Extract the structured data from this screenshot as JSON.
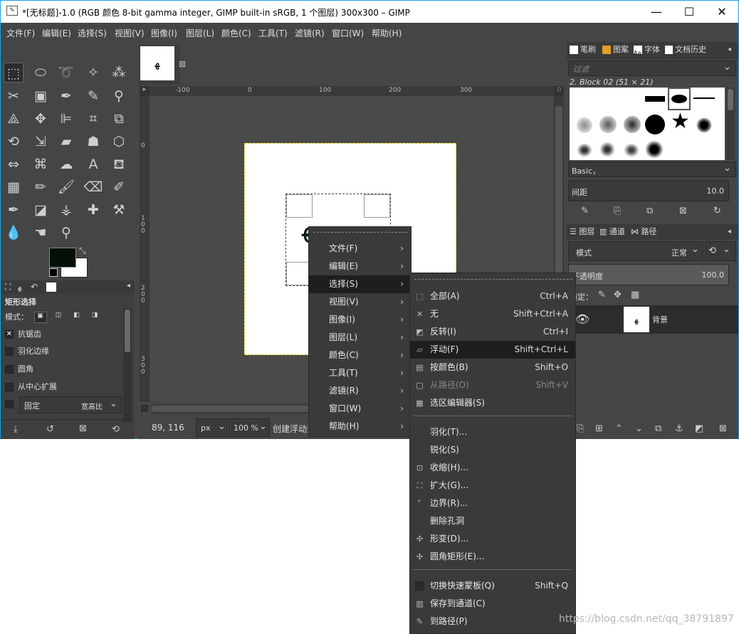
{
  "window": {
    "title": "*[无标题]-1.0 (RGB 颜色 8-bit gamma integer, GIMP built-in sRGB, 1 个图层) 300x300 – GIMP",
    "minimize": "—",
    "maximize": "☐",
    "close": "✕"
  },
  "menubar": [
    "文件(F)",
    "编辑(E)",
    "选择(S)",
    "视图(V)",
    "图像(I)",
    "图层(L)",
    "颜色(C)",
    "工具(T)",
    "滤镜(R)",
    "窗口(W)",
    "帮助(H)"
  ],
  "tool_options": {
    "title": "矩形选择",
    "mode_label": "模式：",
    "antialias": "抗锯齿",
    "feather": "羽化边缘",
    "rounded": "圆角",
    "expand_center": "从中心扩展",
    "fixed": "固定",
    "aspect": "宽高比"
  },
  "canvas": {
    "ruler_h": [
      "-100",
      "0",
      "100",
      "200",
      "300"
    ],
    "ruler_v": [
      "0",
      "1\n0\n0",
      "2\n0\n0",
      "3\n0\n0"
    ],
    "thumb_text": "ﻬ"
  },
  "status": {
    "coords": "89, 116",
    "unit": "px",
    "zoom": "100 %",
    "message": "创建浮动选"
  },
  "dock": {
    "tabs_top": [
      "笔刷",
      "图案",
      "字体",
      "文档历史"
    ],
    "filter_placeholder": "过滤",
    "brush_name": "2. Block 02 (51 × 21)",
    "brush_tag": "Basic，",
    "spacing_label": "间距",
    "spacing_value": "10.0",
    "tabs_layers": [
      "图层",
      "通道",
      "路径"
    ],
    "mode_label": "模式",
    "mode_value": "正常",
    "opacity_label": "不透明度",
    "opacity_value": "100.0",
    "lock_label": "锁定：",
    "layer_name": "背景"
  },
  "main_menu": [
    {
      "label": "文件(F)"
    },
    {
      "label": "编辑(E)"
    },
    {
      "label": "选择(S)",
      "highlight": true
    },
    {
      "label": "视图(V)"
    },
    {
      "label": "图像(I)"
    },
    {
      "label": "图层(L)"
    },
    {
      "label": "颜色(C)"
    },
    {
      "label": "工具(T)"
    },
    {
      "label": "滤镜(R)"
    },
    {
      "label": "窗口(W)"
    },
    {
      "label": "帮助(H)"
    }
  ],
  "select_menu": [
    {
      "label": "全部(A)",
      "shortcut": "Ctrl+A",
      "icon": "select-all-icon",
      "glyph": "⬚"
    },
    {
      "label": "无",
      "shortcut": "Shift+Ctrl+A",
      "icon": "select-none-icon",
      "glyph": "✕"
    },
    {
      "label": "反转(I)",
      "shortcut": "Ctrl+I",
      "icon": "invert-icon",
      "glyph": "◩"
    },
    {
      "label": "浮动(F)",
      "shortcut": "Shift+Ctrl+L",
      "icon": "float-icon",
      "glyph": "▱",
      "highlight": true
    },
    {
      "label": "按颜色(B)",
      "shortcut": "Shift+O",
      "icon": "by-color-icon",
      "glyph": "▤"
    },
    {
      "label": "从路径(O)",
      "shortcut": "Shift+V",
      "icon": "from-path-icon",
      "glyph": "▢",
      "disabled": true
    },
    {
      "label": "选区编辑器(S)",
      "shortcut": "",
      "icon": "selection-editor-icon",
      "glyph": "▦"
    },
    {
      "label": "羽化(T)...",
      "shortcut": "",
      "icon": "",
      "glyph": ""
    },
    {
      "label": "锐化(S)",
      "shortcut": "",
      "icon": "",
      "glyph": ""
    },
    {
      "label": "收缩(H)...",
      "shortcut": "",
      "icon": "shrink-icon",
      "glyph": "⊡"
    },
    {
      "label": "扩大(G)...",
      "shortcut": "",
      "icon": "grow-icon",
      "glyph": "⛶"
    },
    {
      "label": "边界(R)...",
      "shortcut": "",
      "icon": "border-icon",
      "glyph": "⌜"
    },
    {
      "label": "删除孔洞",
      "shortcut": "",
      "icon": "",
      "glyph": ""
    },
    {
      "label": "形变(D)...",
      "shortcut": "",
      "icon": "distort-icon",
      "glyph": "✣"
    },
    {
      "label": "圆角矩形(E)...",
      "shortcut": "",
      "icon": "rounded-rect-icon",
      "glyph": "✣"
    },
    {
      "label": "切换快速蒙板(Q)",
      "shortcut": "Shift+Q",
      "icon": "quickmask-checkbox",
      "glyph": ""
    },
    {
      "label": "保存到通道(C)",
      "shortcut": "",
      "icon": "save-channel-icon",
      "glyph": "▥"
    },
    {
      "label": "到路径(P)",
      "shortcut": "",
      "icon": "to-path-icon",
      "glyph": "✎"
    }
  ],
  "watermark": "https://blog.csdn.net/qq_38791897"
}
